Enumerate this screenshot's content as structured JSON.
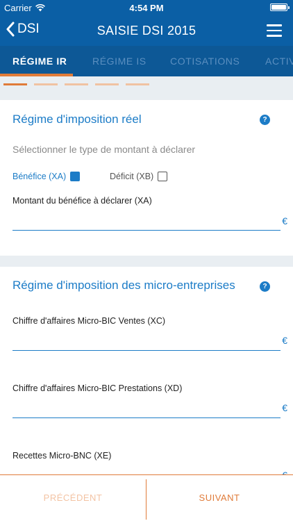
{
  "status_bar": {
    "carrier": "Carrier",
    "time": "4:54 PM",
    "battery_level": 1.0
  },
  "nav": {
    "back_label": "DSI",
    "title": "SAISIE DSI 2015",
    "menu_icon": "hamburger-menu-icon"
  },
  "tabs": [
    {
      "label": "RÉGIME IR",
      "active": true
    },
    {
      "label": "RÉGIME IS",
      "active": false
    },
    {
      "label": "COTISATIONS",
      "active": false
    },
    {
      "label": "ACTIV",
      "active": false
    }
  ],
  "progress": {
    "steps_total": 5,
    "steps_completed": 1
  },
  "section_reel": {
    "title": "Régime d'imposition réel",
    "help": "?",
    "subtitle": "Sélectionner le type de montant à déclarer",
    "option_benefice": {
      "label": "Bénéfice (XA)",
      "checked": true
    },
    "option_deficit": {
      "label": "Déficit (XB)",
      "checked": false
    },
    "field": {
      "label": "Montant du bénéfice à déclarer (XA)",
      "value": "",
      "unit": "€"
    }
  },
  "section_micro": {
    "title": "Régime d'imposition des micro-entreprises",
    "help": "?",
    "fields": [
      {
        "label": "Chiffre d'affaires Micro-BIC Ventes (XC)",
        "value": "",
        "unit": "€"
      },
      {
        "label": "Chiffre d'affaires Micro-BIC Prestations (XD)",
        "value": "",
        "unit": "€"
      },
      {
        "label": "Recettes Micro-BNC (XE)",
        "value": "",
        "unit": "€"
      }
    ]
  },
  "footer": {
    "prev_label": "PRÉCÉDENT",
    "next_label": "SUIVANT"
  },
  "colors": {
    "primary": "#0b5fa5",
    "accent": "#e07b39",
    "link": "#1c7cc7"
  }
}
